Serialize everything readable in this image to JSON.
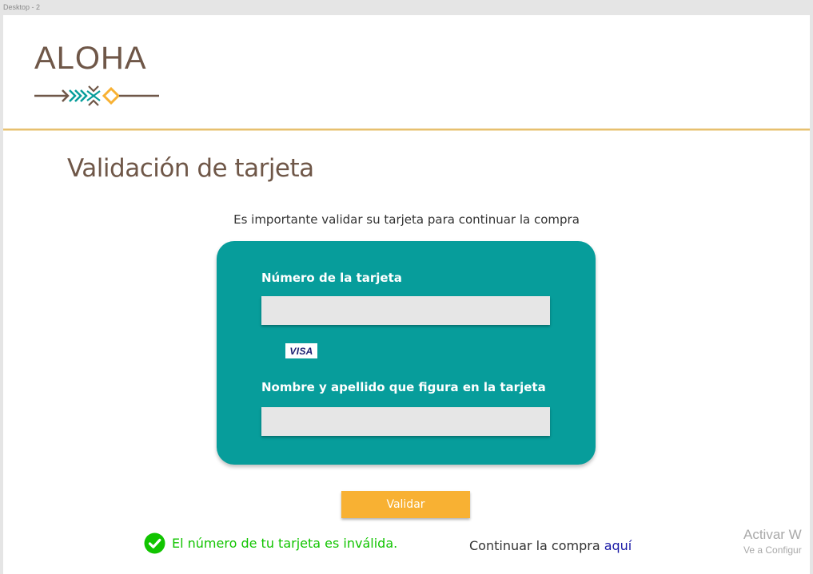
{
  "frame": {
    "label": "Desktop - 2"
  },
  "logo": {
    "text": "ALOHA"
  },
  "page": {
    "title": "Validación de tarjeta",
    "subtitle": "Es importante validar su tarjeta para continuar la compra"
  },
  "form": {
    "card_number_label": "Número de la tarjeta",
    "card_number_value": "",
    "card_brand": "VISA",
    "holder_label": "Nombre y apellido que figura en la tarjeta",
    "holder_value": ""
  },
  "actions": {
    "validate_label": "Validar",
    "status_message": "El número de tu tarjeta es inválida.",
    "status_icon": "check-circle-icon",
    "continue_text": "Continuar la compra ",
    "continue_link": "aquí"
  },
  "overlay": {
    "activate_line1": "Activar W",
    "activate_line2": "Ve a Configur"
  },
  "colors": {
    "brand_brown": "#6f5748",
    "card_teal": "#079d9b",
    "button_orange": "#f8b133",
    "success_green": "#11c400",
    "link_blue": "#1a1aa6",
    "rule_gold": "#e7c06f"
  }
}
